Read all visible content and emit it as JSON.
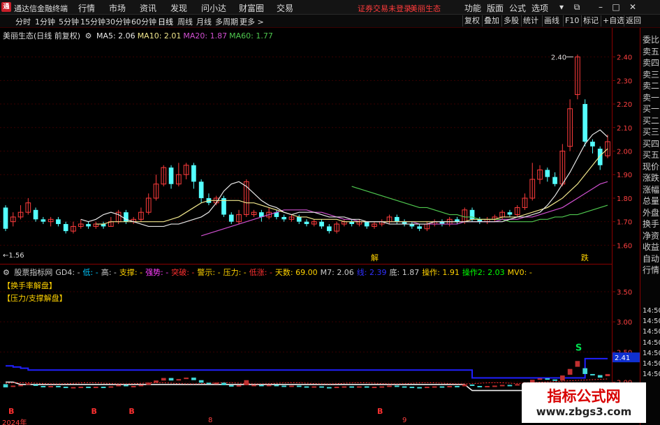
{
  "app": {
    "logo": "通",
    "title": "通达信金融终端",
    "menus": [
      "行情",
      "市场",
      "资讯",
      "发现",
      "问小达",
      "财富圈",
      "交易"
    ],
    "notice": "证券交易未登录",
    "stock_name_notice": "美丽生态",
    "right_menus": [
      "功能",
      "版面",
      "公式",
      "选项"
    ]
  },
  "periods": [
    "分时",
    "1分钟",
    "5分钟",
    "15分钟",
    "30分钟",
    "60分钟",
    "日线",
    "周线",
    "月线",
    "多周期",
    "更多 >"
  ],
  "active_period": "日线",
  "toolbar_right": [
    "复权",
    "叠加",
    "多股",
    "统计",
    "画线",
    "F10",
    "标记",
    "+自选",
    "返回"
  ],
  "main_chart": {
    "stock_title": "美丽生态(日线 前复权)",
    "ma": [
      {
        "label": "MA5: 2.06",
        "color": "#e8e8e8"
      },
      {
        "label": "MA10: 2.01",
        "color": "#f0e68c"
      },
      {
        "label": "MA20: 1.87",
        "color": "#d050d0"
      },
      {
        "label": "MA60: 1.77",
        "color": "#4fc84f"
      }
    ],
    "high_label": "2.40",
    "low_label": "←1.56",
    "signal_buy": "解",
    "signal_sell": "跌",
    "y_ticks": [
      "2.40",
      "2.30",
      "2.20",
      "2.10",
      "2.00",
      "1.90",
      "1.80",
      "1.70",
      "1.60"
    ]
  },
  "sub_chart": {
    "legend": [
      {
        "text": "股票指标网",
        "color": "#cccccc"
      },
      {
        "text": "GD4: -",
        "color": "#cccccc"
      },
      {
        "text": "低: -",
        "color": "#00c8ff"
      },
      {
        "text": "高: -",
        "color": "#cccccc"
      },
      {
        "text": "支撑: -",
        "color": "#ffd200"
      },
      {
        "text": "强势: -",
        "color": "#ff40ff"
      },
      {
        "text": "突破: -",
        "color": "#ff3030"
      },
      {
        "text": "警示: -",
        "color": "#ffd200"
      },
      {
        "text": "压力: -",
        "color": "#ffd200"
      },
      {
        "text": "低涨: -",
        "color": "#ff3030"
      },
      {
        "text": "天数: 69.00",
        "color": "#ffd200"
      },
      {
        "text": "M7: 2.06",
        "color": "#cccccc"
      },
      {
        "text": "线: 2.39",
        "color": "#3030ff"
      },
      {
        "text": "底: 1.87",
        "color": "#cccccc"
      },
      {
        "text": "操作: 1.91",
        "color": "#ffd200"
      },
      {
        "text": "操作2: 2.03",
        "color": "#00ff00"
      },
      {
        "text": "MV0: -",
        "color": "#ffd200"
      }
    ],
    "tag1": "【换手率解盘】",
    "tag2": "【压力/支撑解盘】",
    "signal_s": "S",
    "signals_b": [
      "B",
      "B",
      "B",
      "B"
    ],
    "y_ticks": [
      "3.50",
      "3.00",
      "2.50",
      "2.00"
    ],
    "current_value": "2.41"
  },
  "date_labels": [
    "2024年",
    "8",
    "9"
  ],
  "side_panel": [
    "委比",
    "卖五",
    "卖四",
    "卖三",
    "卖二",
    "卖一",
    "买一",
    "买二",
    "买三",
    "买四",
    "买五",
    "现价",
    "涨跌",
    "涨幅",
    "总量",
    "外盘",
    "换手",
    "净资",
    "收益",
    "自动",
    "行情",
    "14:50",
    "14:50",
    "14:50",
    "14:50",
    "14:50",
    "14:50",
    "14:50"
  ],
  "watermark": {
    "title": "指标公式网",
    "url": "www.zbgs3.com"
  },
  "colors": {
    "up": "#ff3c3c",
    "down": "#54ffff",
    "grid": "#8b0000",
    "axis_text": "#ff4040"
  },
  "chart_data": {
    "type": "candlestick",
    "ylim": [
      1.53,
      2.47
    ],
    "candles": [
      [
        1.76,
        1.67,
        1.77,
        1.66
      ],
      [
        1.7,
        1.72,
        1.74,
        1.68
      ],
      [
        1.72,
        1.74,
        1.77,
        1.71
      ],
      [
        1.74,
        1.78,
        1.8,
        1.73
      ],
      [
        1.75,
        1.71,
        1.76,
        1.7
      ],
      [
        1.71,
        1.7,
        1.72,
        1.69
      ],
      [
        1.7,
        1.71,
        1.72,
        1.68
      ],
      [
        1.71,
        1.69,
        1.72,
        1.68
      ],
      [
        1.69,
        1.66,
        1.7,
        1.65
      ],
      [
        1.66,
        1.68,
        1.7,
        1.65
      ],
      [
        1.68,
        1.69,
        1.71,
        1.67
      ],
      [
        1.69,
        1.68,
        1.7,
        1.67
      ],
      [
        1.68,
        1.69,
        1.7,
        1.67
      ],
      [
        1.69,
        1.68,
        1.7,
        1.67
      ],
      [
        1.68,
        1.7,
        1.72,
        1.68
      ],
      [
        1.7,
        1.74,
        1.75,
        1.69
      ],
      [
        1.74,
        1.7,
        1.75,
        1.69
      ],
      [
        1.7,
        1.71,
        1.72,
        1.69
      ],
      [
        1.71,
        1.74,
        1.76,
        1.7
      ],
      [
        1.74,
        1.8,
        1.82,
        1.73
      ],
      [
        1.8,
        1.86,
        1.9,
        1.79
      ],
      [
        1.86,
        1.93,
        1.94,
        1.85
      ],
      [
        1.93,
        1.86,
        1.94,
        1.84
      ],
      [
        1.86,
        1.9,
        1.95,
        1.85
      ],
      [
        1.9,
        1.94,
        1.95,
        1.88
      ],
      [
        1.94,
        1.87,
        1.95,
        1.84
      ],
      [
        1.87,
        1.8,
        1.88,
        1.78
      ],
      [
        1.8,
        1.78,
        1.82,
        1.77
      ],
      [
        1.78,
        1.8,
        1.81,
        1.77
      ],
      [
        1.8,
        1.73,
        1.81,
        1.72
      ],
      [
        1.73,
        1.7,
        1.74,
        1.69
      ],
      [
        1.7,
        1.73,
        1.75,
        1.69
      ],
      [
        1.73,
        1.87,
        1.88,
        1.72
      ],
      [
        1.73,
        1.74,
        1.75,
        1.72
      ],
      [
        1.74,
        1.72,
        1.75,
        1.7
      ],
      [
        1.72,
        1.74,
        1.76,
        1.71
      ],
      [
        1.74,
        1.72,
        1.75,
        1.71
      ],
      [
        1.72,
        1.71,
        1.73,
        1.7
      ],
      [
        1.71,
        1.72,
        1.73,
        1.7
      ],
      [
        1.72,
        1.7,
        1.73,
        1.69
      ],
      [
        1.7,
        1.69,
        1.71,
        1.68
      ],
      [
        1.69,
        1.7,
        1.71,
        1.68
      ],
      [
        1.7,
        1.68,
        1.71,
        1.67
      ],
      [
        1.68,
        1.66,
        1.69,
        1.65
      ],
      [
        1.66,
        1.69,
        1.7,
        1.65
      ],
      [
        1.69,
        1.7,
        1.71,
        1.68
      ],
      [
        1.7,
        1.69,
        1.71,
        1.68
      ],
      [
        1.69,
        1.7,
        1.71,
        1.68
      ],
      [
        1.7,
        1.68,
        1.7,
        1.67
      ],
      [
        1.68,
        1.69,
        1.7,
        1.67
      ],
      [
        1.69,
        1.7,
        1.71,
        1.68
      ],
      [
        1.7,
        1.72,
        1.73,
        1.69
      ],
      [
        1.72,
        1.7,
        1.73,
        1.69
      ],
      [
        1.7,
        1.69,
        1.71,
        1.68
      ],
      [
        1.69,
        1.68,
        1.7,
        1.67
      ],
      [
        1.68,
        1.67,
        1.69,
        1.66
      ],
      [
        1.67,
        1.69,
        1.7,
        1.66
      ],
      [
        1.69,
        1.7,
        1.71,
        1.68
      ],
      [
        1.7,
        1.69,
        1.71,
        1.68
      ],
      [
        1.69,
        1.71,
        1.72,
        1.68
      ],
      [
        1.71,
        1.7,
        1.72,
        1.69
      ],
      [
        1.7,
        1.75,
        1.76,
        1.69
      ],
      [
        1.75,
        1.71,
        1.76,
        1.7
      ],
      [
        1.71,
        1.7,
        1.72,
        1.69
      ],
      [
        1.7,
        1.71,
        1.72,
        1.69
      ],
      [
        1.71,
        1.72,
        1.73,
        1.7
      ],
      [
        1.72,
        1.74,
        1.75,
        1.71
      ],
      [
        1.74,
        1.73,
        1.75,
        1.72
      ],
      [
        1.73,
        1.76,
        1.77,
        1.72
      ],
      [
        1.76,
        1.8,
        1.82,
        1.75
      ],
      [
        1.8,
        1.88,
        1.95,
        1.79
      ],
      [
        1.88,
        1.92,
        1.94,
        1.86
      ],
      [
        1.92,
        1.89,
        1.93,
        1.87
      ],
      [
        1.89,
        1.86,
        1.91,
        1.85
      ],
      [
        1.86,
        2.0,
        2.03,
        1.85
      ],
      [
        2.02,
        2.18,
        2.22,
        2.0
      ],
      [
        2.24,
        2.4,
        2.41,
        2.22
      ],
      [
        2.2,
        2.04,
        2.22,
        2.02
      ],
      [
        2.04,
        2.02,
        2.05,
        1.99
      ],
      [
        2.01,
        1.94,
        2.02,
        1.92
      ],
      [
        1.98,
        2.04,
        2.07,
        1.97
      ]
    ],
    "ma5": [
      1.71,
      1.7,
      1.71,
      1.73,
      1.74,
      1.73,
      1.71,
      1.7,
      1.69,
      1.68,
      1.68,
      1.68,
      1.69,
      1.69,
      1.7,
      1.71,
      1.72,
      1.74,
      1.78,
      1.83,
      1.86,
      1.87,
      1.85,
      1.82,
      1.79,
      1.77,
      1.76,
      1.74,
      1.73,
      1.74,
      1.74,
      1.74,
      1.73,
      1.72,
      1.72,
      1.72,
      1.71,
      1.71,
      1.7,
      1.7,
      1.7,
      1.69,
      1.69,
      1.69,
      1.69,
      1.69,
      1.69,
      1.7,
      1.7,
      1.7,
      1.7,
      1.7,
      1.7,
      1.7,
      1.7,
      1.7,
      1.7,
      1.71,
      1.72,
      1.72,
      1.73,
      1.74,
      1.77,
      1.81,
      1.86,
      1.91,
      1.97,
      2.03,
      2.07,
      2.09,
      2.06
    ],
    "ma10": [
      1.69,
      1.69,
      1.7,
      1.7,
      1.7,
      1.7,
      1.7,
      1.7,
      1.7,
      1.7,
      1.71,
      1.72,
      1.74,
      1.76,
      1.78,
      1.79,
      1.79,
      1.79,
      1.79,
      1.79,
      1.78,
      1.78,
      1.77,
      1.76,
      1.75,
      1.74,
      1.73,
      1.72,
      1.72,
      1.71,
      1.71,
      1.71,
      1.71,
      1.7,
      1.7,
      1.7,
      1.7,
      1.7,
      1.7,
      1.7,
      1.7,
      1.7,
      1.7,
      1.7,
      1.7,
      1.7,
      1.7,
      1.7,
      1.7,
      1.7,
      1.71,
      1.71,
      1.71,
      1.71,
      1.72,
      1.72,
      1.72,
      1.73,
      1.74,
      1.75,
      1.76,
      1.78,
      1.8,
      1.83,
      1.86,
      1.9,
      1.94,
      1.98,
      2.01
    ],
    "ma20": [
      1.64,
      1.65,
      1.66,
      1.67,
      1.68,
      1.69,
      1.7,
      1.71,
      1.72,
      1.73,
      1.74,
      1.75,
      1.75,
      1.75,
      1.75,
      1.74,
      1.74,
      1.73,
      1.72,
      1.71,
      1.71,
      1.7,
      1.7,
      1.7,
      1.7,
      1.7,
      1.7,
      1.7,
      1.7,
      1.69,
      1.69,
      1.69,
      1.69,
      1.69,
      1.69,
      1.7,
      1.7,
      1.7,
      1.7,
      1.7,
      1.71,
      1.71,
      1.71,
      1.72,
      1.72,
      1.73,
      1.74,
      1.75,
      1.76,
      1.78,
      1.8,
      1.82,
      1.84,
      1.86,
      1.87
    ],
    "ma60": [
      1.85,
      1.84,
      1.83,
      1.82,
      1.81,
      1.8,
      1.79,
      1.78,
      1.77,
      1.76,
      1.76,
      1.75,
      1.74,
      1.73,
      1.73,
      1.72,
      1.72,
      1.71,
      1.71,
      1.71,
      1.71,
      1.7,
      1.7,
      1.7,
      1.7,
      1.71,
      1.71,
      1.72,
      1.72,
      1.73,
      1.73,
      1.74,
      1.75,
      1.76,
      1.77
    ]
  }
}
